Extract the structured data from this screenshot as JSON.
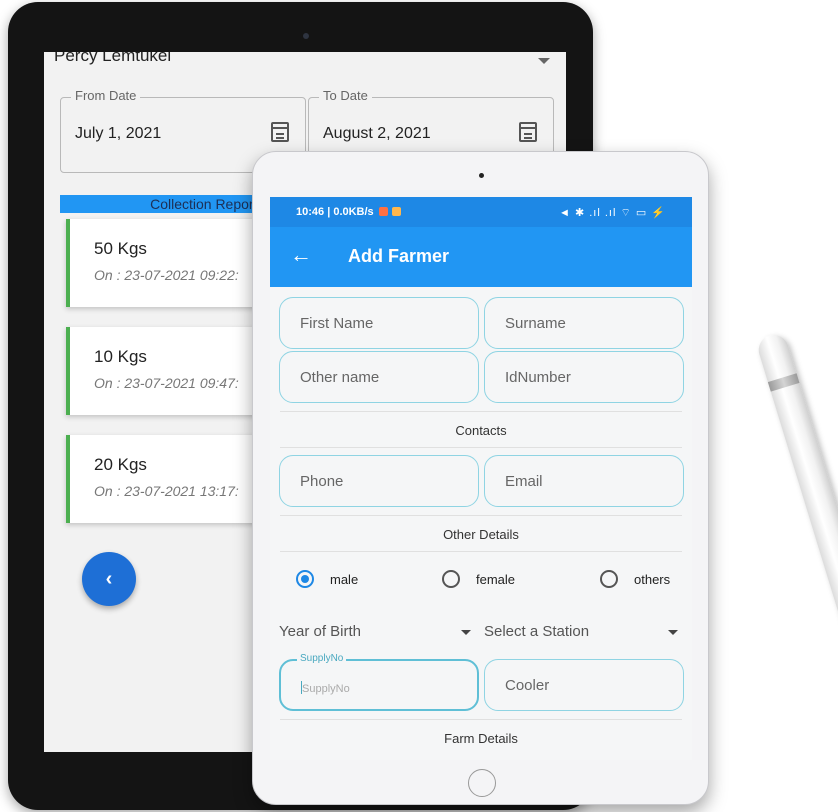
{
  "back_screen": {
    "user_name": "Percy Lemtukei",
    "from_date": {
      "label": "From Date",
      "value": "July 1, 2021"
    },
    "to_date": {
      "label": "To Date",
      "value": "August 2, 2021"
    },
    "report_header": "Collection Report fr",
    "records": [
      {
        "weight": "50 Kgs",
        "date": "On : 23-07-2021 09:22:"
      },
      {
        "weight": "10 Kgs",
        "date": "On : 23-07-2021 09:47:"
      },
      {
        "weight": "20 Kgs",
        "date": "On : 23-07-2021 13:17:"
      }
    ],
    "back_button": "‹"
  },
  "front_screen": {
    "status_bar": {
      "left": "10:46 | 0.0KB/s",
      "right": "◄ ✱ .ıl .ıl ⌔ ▭ ⚡"
    },
    "app_bar": {
      "back": "←",
      "title": "Add Farmer"
    },
    "fields": {
      "first_name": "First Name",
      "surname": "Surname",
      "other_name": "Other name",
      "id_number": "IdNumber",
      "phone": "Phone",
      "email": "Email",
      "supply_no_label": "SupplyNo",
      "supply_no_placeholder": "SupplyNo",
      "cooler": "Cooler"
    },
    "sections": {
      "contacts": "Contacts",
      "other_details": "Other Details",
      "farm_details": "Farm Details"
    },
    "gender": {
      "options": [
        "male",
        "female",
        "others"
      ],
      "selected": "male"
    },
    "dropdowns": {
      "year_of_birth": "Year of Birth",
      "station": "Select a Station"
    }
  },
  "colors": {
    "app_bar": "#2196f3",
    "status_bar": "#1e88e5",
    "field_border": "#8fd4e3",
    "card_accent": "#4caf50",
    "fab": "#1e6fd6"
  }
}
